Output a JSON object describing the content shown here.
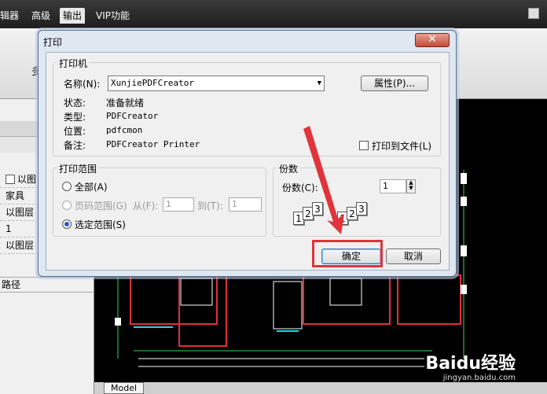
{
  "menubar": {
    "items": [
      "辑器",
      "高级",
      "输出",
      "VIP功能"
    ],
    "active_index": 2
  },
  "ribbon": {
    "fragment_label": "多"
  },
  "left_panel": {
    "rows": [
      "以图",
      "家具",
      "以图层",
      "1",
      "以图层"
    ],
    "path_label": "路径"
  },
  "canvas": {
    "tab_model": "Model",
    "watermark": "Baidu经验",
    "watermark_url": "jingyan.baidu.com"
  },
  "dialog": {
    "title": "打印",
    "close_symbol": "✕",
    "printer_group": {
      "label": "打印机",
      "name_label": "名称(N):",
      "name_value": "XunjiePDFCreator",
      "properties_button": "属性(P)...",
      "status_label": "状态:",
      "status_value": "准备就绪",
      "type_label": "类型:",
      "type_value": "PDFCreator",
      "where_label": "位置:",
      "where_value": "pdfcmon",
      "comment_label": "备注:",
      "comment_value": "PDFCreator Printer",
      "print_to_file_label": "打印到文件(L)"
    },
    "range_group": {
      "label": "打印范围",
      "all_label": "全部(A)",
      "pages_label": "页码范围(G)",
      "from_label": "从(F):",
      "from_value": "1",
      "to_label": "到(T):",
      "to_value": "1",
      "selection_label": "选定范围(S)",
      "selected": "selection"
    },
    "copies_group": {
      "label": "份数",
      "copies_label": "份数(C):",
      "copies_value": "1",
      "collate_pages": [
        "1",
        "2",
        "3",
        "1",
        "2",
        "3"
      ]
    },
    "ok_button": "确定",
    "cancel_button": "取消"
  },
  "annotation": {
    "color": "#e0343a"
  }
}
